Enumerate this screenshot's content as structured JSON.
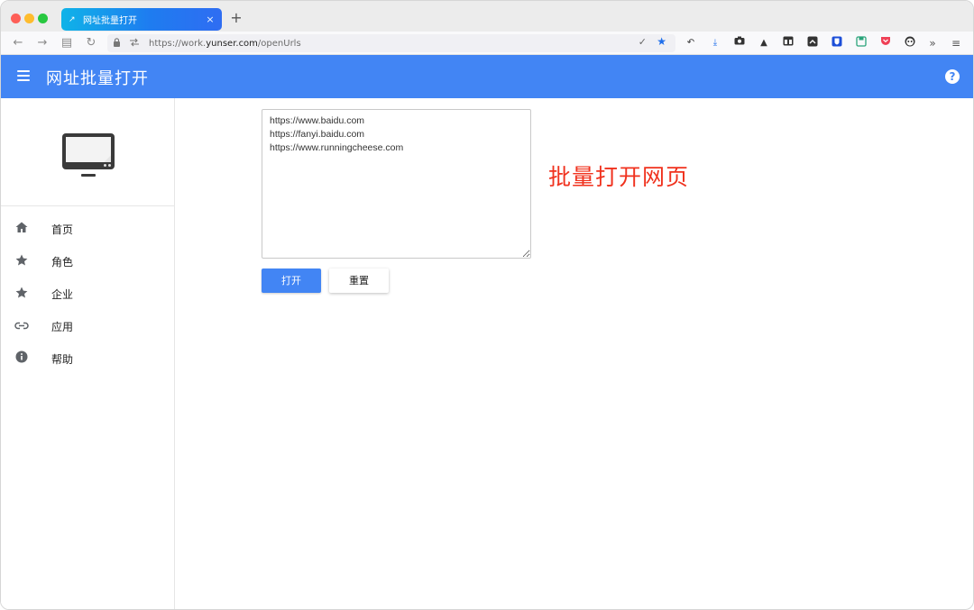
{
  "browser": {
    "tab": {
      "title": "网址批量打开",
      "close_glyph": "×",
      "favicon": "↗"
    },
    "new_tab_glyph": "+",
    "url": {
      "prefix": "https://work.",
      "domain": "yunser.com",
      "path": "/openUrls"
    },
    "nav": {
      "back": "←",
      "forward": "→",
      "reader": "▤",
      "reload": "↻"
    }
  },
  "header": {
    "title": "网址批量打开",
    "help": "?"
  },
  "sidebar": {
    "items": [
      {
        "label": "首页",
        "icon": "home-icon"
      },
      {
        "label": "角色",
        "icon": "star-icon"
      },
      {
        "label": "企业",
        "icon": "star-icon"
      },
      {
        "label": "应用",
        "icon": "link-icon"
      },
      {
        "label": "帮助",
        "icon": "info-icon"
      }
    ]
  },
  "main": {
    "urls_text": "https://www.baidu.com\nhttps://fanyi.baidu.com\nhttps://www.runningcheese.com",
    "headline": "批量打开网页",
    "open_label": "打开",
    "reset_label": "重置"
  },
  "colors": {
    "brand": "#4285f4",
    "headline": "#f0321e"
  }
}
